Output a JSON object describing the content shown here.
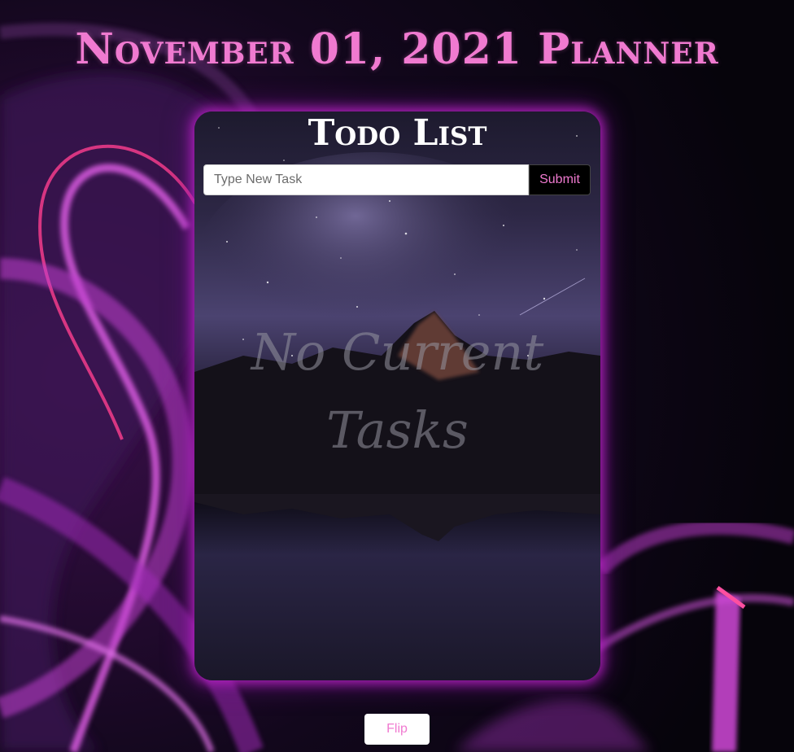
{
  "header": {
    "title": "November 01, 2021 Planner"
  },
  "todo": {
    "title": "Todo List",
    "input_placeholder": "Type New Task",
    "input_value": "",
    "submit_label": "Submit",
    "empty_message": "No Current Tasks"
  },
  "footer": {
    "flip_label": "Flip"
  },
  "colors": {
    "accent": "#f07ad0",
    "background": "#07040d",
    "glow": "#ba22c4"
  },
  "images": {
    "background": "abstract-purple-light-swirls",
    "card_background": "night-sky-mountain-lake-reflection"
  }
}
